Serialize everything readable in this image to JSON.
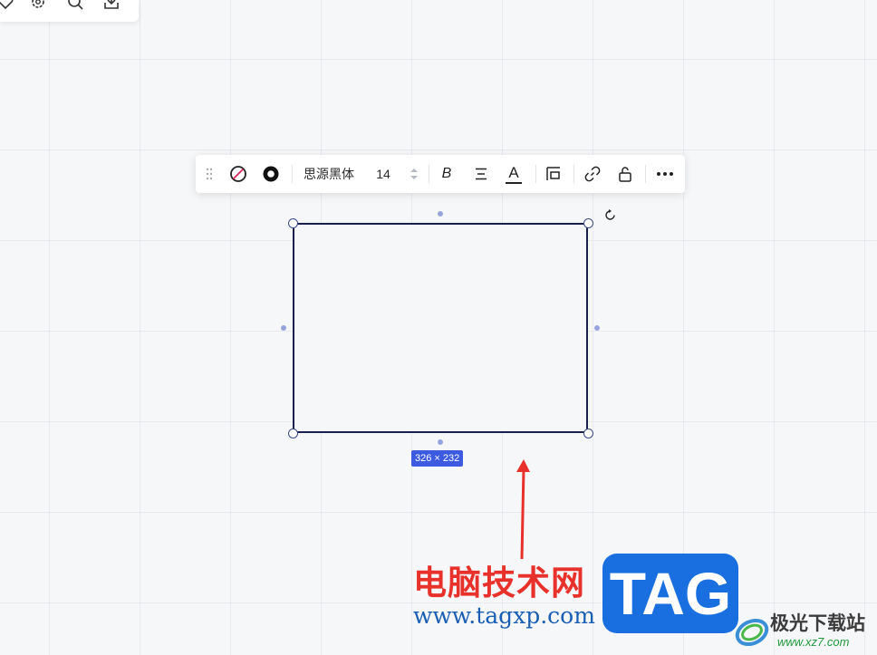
{
  "top_toolbar": {
    "icons": [
      "heart-icon",
      "settings-icon",
      "search-icon",
      "download-icon"
    ]
  },
  "toolbar": {
    "font_family": "思源黑体",
    "font_size": "14",
    "bold_label": "B",
    "text_color_label": "A",
    "items": [
      "fill-none-icon",
      "stroke-color-icon",
      "font-family-select",
      "font-size-stepper",
      "bold-icon",
      "align-icon",
      "text-color-icon",
      "position-icon",
      "link-icon",
      "unlock-icon",
      "more-icon"
    ]
  },
  "selection": {
    "size_label": "326 × 232"
  },
  "colors": {
    "canvas": "#f6f7f9",
    "grid": "#e7e9ee",
    "shape_border": "#1a1f4e",
    "handle_dot": "#97a3dc",
    "badge": "#3d5be0",
    "arrow": "#e8312a"
  },
  "watermark": {
    "title": "电脑技术网",
    "url": "www.tagxp.com",
    "tag": "TAG",
    "site_name": "极光下载站",
    "site_url": "www.xz7.com"
  }
}
